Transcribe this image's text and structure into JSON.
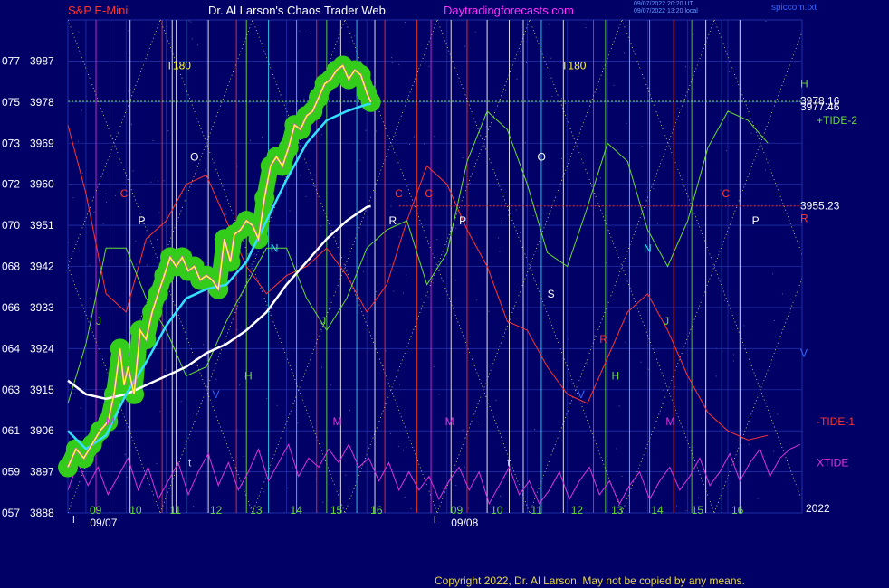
{
  "header": {
    "instrument": "S&P E-Mini",
    "site": "Dr. Al Larson's Chaos Trader Web",
    "url": "Daytradingforecasts.com",
    "stamp1": "09/07/2022 20:20 UT",
    "stamp2": "09/07/2022 13:20 local",
    "file": "spiccom.txt"
  },
  "copyright": "Copyright 2022, Dr. Al Larson. May not be copied by any means.",
  "colors": {
    "background": "#000066",
    "grid": "#1f2fa8",
    "price": "#ffff33",
    "ema_cyan": "#33e0ff",
    "ema_white": "#ffffff",
    "glow": "#33cc1a",
    "tide_plus": "#66dd33",
    "tide_minus": "#ff3333",
    "xtide": "#dd33dd"
  },
  "chart_data": {
    "type": "line",
    "ylim": [
      3888,
      3996
    ],
    "y_ticks": [
      {
        "price": 3888,
        "left": "057",
        "label": "3888"
      },
      {
        "price": 3897,
        "left": "059",
        "label": "3897"
      },
      {
        "price": 3906,
        "left": "061",
        "label": "3906"
      },
      {
        "price": 3915,
        "left": "063",
        "label": "3915"
      },
      {
        "price": 3924,
        "left": "064",
        "label": "3924"
      },
      {
        "price": 3933,
        "left": "066",
        "label": "3933"
      },
      {
        "price": 3942,
        "left": "068",
        "label": "3942"
      },
      {
        "price": 3951,
        "left": "070",
        "label": "3951"
      },
      {
        "price": 3960,
        "left": "072",
        "label": "3960"
      },
      {
        "price": 3969,
        "left": "073",
        "label": "3969"
      },
      {
        "price": 3978,
        "left": "075",
        "label": "3978"
      },
      {
        "price": 3987,
        "left": "077",
        "label": "3987"
      }
    ],
    "xlim": [
      8.55,
      26.85
    ],
    "x_ticks": [
      {
        "t": 9,
        "label": "09"
      },
      {
        "t": 10,
        "label": "10"
      },
      {
        "t": 11,
        "label": "11"
      },
      {
        "t": 12,
        "label": "12"
      },
      {
        "t": 13,
        "label": "13"
      },
      {
        "t": 14,
        "label": "14"
      },
      {
        "t": 15,
        "label": "15"
      },
      {
        "t": 16,
        "label": "16"
      },
      {
        "t": 18,
        "label": "09"
      },
      {
        "t": 19,
        "label": "10"
      },
      {
        "t": 20,
        "label": "11"
      },
      {
        "t": 21,
        "label": "12"
      },
      {
        "t": 22,
        "label": "13"
      },
      {
        "t": 23,
        "label": "14"
      },
      {
        "t": 24,
        "label": "15"
      },
      {
        "t": 25,
        "label": "16"
      }
    ],
    "date_labels": [
      {
        "t": 9.1,
        "label": "09/07"
      },
      {
        "t": 18.1,
        "label": "09/08"
      }
    ],
    "year_label": "2022",
    "right_labels": [
      {
        "price": 3982,
        "text": "H",
        "color": "#66dd33"
      },
      {
        "price": 3978.3,
        "text": "3978.16",
        "color": "#ffffff"
      },
      {
        "price": 3977,
        "text": "3977.46",
        "color": "#ffffff"
      },
      {
        "price": 3974,
        "text": "+TIDE-2",
        "color": "#66dd33"
      },
      {
        "price": 3955.23,
        "text": "3955.23",
        "color": "#ffffff"
      },
      {
        "price": 3952.5,
        "text": "R",
        "color": "#ff3333"
      },
      {
        "price": 3923,
        "text": "V",
        "color": "#3366ff"
      },
      {
        "price": 3908,
        "text": "-TIDE-1",
        "color": "#ff3333"
      },
      {
        "price": 3899,
        "text": "XTIDE",
        "color": "#dd33dd"
      }
    ],
    "annotations": [
      {
        "t": 11.0,
        "price": 3986,
        "text": "T180",
        "color": "#ffff33"
      },
      {
        "t": 20.85,
        "price": 3986,
        "text": "T180",
        "color": "#ffff33"
      },
      {
        "t": 11.6,
        "price": 3966,
        "text": "O",
        "color": "#ffffff"
      },
      {
        "t": 20.25,
        "price": 3966,
        "text": "O",
        "color": "#ffffff"
      },
      {
        "t": 9.85,
        "price": 3958,
        "text": "C",
        "color": "#ff3333"
      },
      {
        "t": 16.7,
        "price": 3958,
        "text": "C",
        "color": "#ff3333"
      },
      {
        "t": 17.45,
        "price": 3958,
        "text": "C",
        "color": "#ff3333"
      },
      {
        "t": 24.85,
        "price": 3958,
        "text": "C",
        "color": "#ff3333"
      },
      {
        "t": 10.3,
        "price": 3952,
        "text": "P",
        "color": "#ffffff"
      },
      {
        "t": 18.3,
        "price": 3952,
        "text": "P",
        "color": "#ffffff"
      },
      {
        "t": 25.6,
        "price": 3952,
        "text": "P",
        "color": "#ffffff"
      },
      {
        "t": 16.55,
        "price": 3952,
        "text": "R",
        "color": "#ffffff"
      },
      {
        "t": 13.6,
        "price": 3946,
        "text": "N",
        "color": "#33e0ff"
      },
      {
        "t": 22.9,
        "price": 3946,
        "text": "N",
        "color": "#33e0ff"
      },
      {
        "t": 20.5,
        "price": 3936,
        "text": "S",
        "color": "#ffffff"
      },
      {
        "t": 9.25,
        "price": 3930,
        "text": "J",
        "color": "#66dd33"
      },
      {
        "t": 14.85,
        "price": 3930,
        "text": "J",
        "color": "#66dd33"
      },
      {
        "t": 23.4,
        "price": 3930,
        "text": "J",
        "color": "#66dd33"
      },
      {
        "t": 21.8,
        "price": 3926,
        "text": "R",
        "color": "#ff3333"
      },
      {
        "t": 12.95,
        "price": 3918,
        "text": "H",
        "color": "#66dd33"
      },
      {
        "t": 22.1,
        "price": 3918,
        "text": "H",
        "color": "#66dd33"
      },
      {
        "t": 12.15,
        "price": 3914,
        "text": "V",
        "color": "#3366ff"
      },
      {
        "t": 21.25,
        "price": 3914,
        "text": "V",
        "color": "#3366ff"
      },
      {
        "t": 9.5,
        "price": 3908,
        "text": "M",
        "color": "#dd33dd"
      },
      {
        "t": 15.15,
        "price": 3908,
        "text": "M",
        "color": "#dd33dd"
      },
      {
        "t": 17.95,
        "price": 3908,
        "text": "M",
        "color": "#dd33dd"
      },
      {
        "t": 23.45,
        "price": 3908,
        "text": "M",
        "color": "#dd33dd"
      },
      {
        "t": 11.55,
        "price": 3899,
        "text": "t",
        "color": "#ccccff"
      },
      {
        "t": 19.5,
        "price": 3899,
        "text": "t",
        "color": "#ccccff"
      }
    ],
    "vertical_lines": [
      {
        "t": 9.25,
        "color": "#dd33dd"
      },
      {
        "t": 9.6,
        "color": "#ff3333"
      },
      {
        "t": 10.1,
        "color": "#ffffff"
      },
      {
        "t": 10.9,
        "color": "#ff3333"
      },
      {
        "t": 11.15,
        "color": "#ffffff"
      },
      {
        "t": 11.25,
        "color": "#ffffff"
      },
      {
        "t": 11.5,
        "color": "#33e0ff"
      },
      {
        "t": 12.05,
        "color": "#ffffff"
      },
      {
        "t": 12.75,
        "color": "#ff3333"
      },
      {
        "t": 13.0,
        "color": "#66dd33"
      },
      {
        "t": 13.55,
        "color": "#33e0ff"
      },
      {
        "t": 14.25,
        "color": "#33e0ff"
      },
      {
        "t": 14.75,
        "color": "#ff3333"
      },
      {
        "t": 15.0,
        "color": "#66dd33"
      },
      {
        "t": 15.35,
        "color": "#ffffff"
      },
      {
        "t": 15.75,
        "color": "#33e0ff"
      },
      {
        "t": 16.2,
        "color": "#ffffff"
      },
      {
        "t": 16.45,
        "color": "#ff3333"
      },
      {
        "t": 17.25,
        "color": "#ff3333"
      },
      {
        "t": 17.6,
        "color": "#dd33dd"
      },
      {
        "t": 18.1,
        "color": "#ffffff"
      },
      {
        "t": 18.5,
        "color": "#ff3333"
      },
      {
        "t": 19.0,
        "color": "#ffffff"
      },
      {
        "t": 19.55,
        "color": "#ffffff"
      },
      {
        "t": 19.9,
        "color": "#ffffff"
      },
      {
        "t": 20.35,
        "color": "#33e0ff"
      },
      {
        "t": 20.9,
        "color": "#ffffff"
      },
      {
        "t": 21.65,
        "color": "#ff3333"
      },
      {
        "t": 21.95,
        "color": "#66dd33"
      },
      {
        "t": 22.55,
        "color": "#33e0ff"
      },
      {
        "t": 23.05,
        "color": "#33e0ff"
      },
      {
        "t": 23.65,
        "color": "#ff3333"
      },
      {
        "t": 24.1,
        "color": "#66dd33"
      },
      {
        "t": 24.45,
        "color": "#ffffff"
      },
      {
        "t": 24.85,
        "color": "#33e0ff"
      },
      {
        "t": 25.3,
        "color": "#ffffff"
      }
    ],
    "h_lines": [
      {
        "price": 3978.16,
        "color": "#66dd33",
        "from": 8.55
      },
      {
        "price": 3955.23,
        "color": "#ff3333",
        "from": 16.8
      }
    ],
    "series": [
      {
        "name": "price",
        "color": "#ffff33",
        "x": [
          8.55,
          8.75,
          8.95,
          9.15,
          9.35,
          9.55,
          9.7,
          9.85,
          9.95,
          10.05,
          10.2,
          10.35,
          10.5,
          10.65,
          10.8,
          10.95,
          11.1,
          11.25,
          11.4,
          11.55,
          11.7,
          11.85,
          12.0,
          12.15,
          12.3,
          12.45,
          12.6,
          12.7,
          12.85,
          13.0,
          13.15,
          13.3,
          13.45,
          13.6,
          13.75,
          13.9,
          14.05,
          14.2,
          14.35,
          14.5,
          14.65,
          14.8,
          14.95,
          15.1,
          15.25,
          15.4,
          15.55,
          15.7,
          15.85,
          16.0,
          16.1
        ],
        "values": [
          3898,
          3902,
          3900,
          3903,
          3906,
          3908,
          3914,
          3924,
          3916,
          3920,
          3914,
          3928,
          3926,
          3932,
          3936,
          3940,
          3944,
          3942,
          3944,
          3941,
          3942,
          3939,
          3940,
          3939,
          3937,
          3948,
          3943,
          3949,
          3950,
          3952,
          3951,
          3948,
          3957,
          3964,
          3966,
          3964,
          3968,
          3973,
          3972,
          3975,
          3976,
          3979,
          3982,
          3983,
          3985,
          3986,
          3983,
          3985,
          3984,
          3980,
          3978
        ]
      },
      {
        "name": "ema",
        "color": "#33e0ff",
        "x": [
          8.55,
          9.0,
          9.5,
          10.0,
          10.5,
          11.0,
          11.5,
          12.0,
          12.5,
          13.0,
          13.5,
          14.0,
          14.5,
          15.0,
          15.5,
          16.0,
          16.1
        ],
        "values": [
          3906,
          3902,
          3905,
          3914,
          3921,
          3929,
          3935,
          3937,
          3938,
          3943,
          3952,
          3961,
          3969,
          3974,
          3976,
          3977.5,
          3977.6
        ]
      },
      {
        "name": "ema-slow",
        "color": "#ffffff",
        "x": [
          8.55,
          9.0,
          9.5,
          10.0,
          10.5,
          11.0,
          11.5,
          12.0,
          12.5,
          13.0,
          13.5,
          14.0,
          14.5,
          15.0,
          15.5,
          16.0,
          16.1
        ],
        "values": [
          3917,
          3914,
          3913,
          3914,
          3916,
          3918,
          3920,
          3923,
          3925,
          3928,
          3932,
          3938,
          3943,
          3948,
          3952,
          3955,
          3955.2
        ]
      },
      {
        "name": "+TIDE-2",
        "color": "#66dd33",
        "x": [
          8.55,
          9.0,
          9.5,
          10.0,
          10.5,
          11.0,
          11.5,
          12.0,
          12.5,
          13.0,
          13.5,
          14.0,
          14.5,
          15.0,
          15.5,
          16.0,
          16.5,
          17.0,
          17.5,
          18.0,
          18.5,
          19.0,
          19.5,
          20.0,
          20.5,
          21.0,
          21.5,
          22.0,
          22.5,
          23.0,
          23.5,
          24.0,
          24.5,
          25.0,
          25.5,
          26.0
        ],
        "values": [
          3912,
          3925,
          3946,
          3946,
          3935,
          3928,
          3918,
          3920,
          3930,
          3938,
          3946,
          3946,
          3935,
          3928,
          3935,
          3946,
          3950,
          3952,
          3938,
          3945,
          3965,
          3976,
          3972,
          3960,
          3945,
          3942,
          3955,
          3969,
          3965,
          3950,
          3942,
          3952,
          3968,
          3976,
          3974,
          3969
        ]
      },
      {
        "name": "-TIDE-1",
        "color": "#ff3333",
        "x": [
          8.55,
          9.0,
          9.5,
          10.0,
          10.5,
          11.0,
          11.5,
          12.0,
          12.5,
          13.0,
          13.5,
          14.0,
          14.5,
          15.0,
          15.5,
          16.0,
          16.5,
          17.0,
          17.5,
          18.0,
          18.5,
          19.0,
          19.5,
          20.0,
          20.5,
          21.0,
          21.5,
          22.0,
          22.5,
          23.0,
          23.5,
          24.0,
          24.5,
          25.0,
          25.5,
          26.0
        ],
        "values": [
          3973,
          3958,
          3936,
          3932,
          3948,
          3952,
          3960,
          3962,
          3952,
          3942,
          3936,
          3940,
          3942,
          3946,
          3940,
          3932,
          3938,
          3952,
          3964,
          3960,
          3950,
          3942,
          3930,
          3928,
          3920,
          3914,
          3912,
          3922,
          3932,
          3936,
          3928,
          3918,
          3910,
          3906,
          3904,
          3905
        ]
      },
      {
        "name": "XTIDE",
        "color": "#dd33dd",
        "x": [
          8.55,
          8.8,
          9.05,
          9.3,
          9.55,
          9.8,
          10.05,
          10.3,
          10.55,
          10.8,
          11.05,
          11.3,
          11.55,
          11.8,
          12.05,
          12.3,
          12.55,
          12.8,
          13.05,
          13.3,
          13.55,
          13.8,
          14.05,
          14.3,
          14.55,
          14.8,
          15.05,
          15.3,
          15.55,
          15.8,
          16.05,
          16.3,
          16.55,
          16.8,
          17.05,
          17.3,
          17.55,
          17.8,
          18.05,
          18.3,
          18.55,
          18.8,
          19.05,
          19.3,
          19.55,
          19.8,
          20.05,
          20.3,
          20.55,
          20.8,
          21.05,
          21.3,
          21.55,
          21.8,
          22.05,
          22.3,
          22.55,
          22.8,
          23.05,
          23.3,
          23.55,
          23.8,
          24.05,
          24.3,
          24.55,
          24.8,
          25.05,
          25.3,
          25.55,
          25.8,
          26.05,
          26.3,
          26.55,
          26.8
        ],
        "values": [
          3893,
          3899,
          3894,
          3898,
          3892,
          3896,
          3900,
          3893,
          3898,
          3891,
          3895,
          3899,
          3892,
          3897,
          3901,
          3894,
          3899,
          3893,
          3897,
          3902,
          3895,
          3899,
          3903,
          3896,
          3900,
          3898,
          3902,
          3899,
          3903,
          3898,
          3900,
          3895,
          3899,
          3893,
          3897,
          3893,
          3896,
          3891,
          3895,
          3898,
          3893,
          3897,
          3890,
          3894,
          3898,
          3892,
          3895,
          3890,
          3893,
          3897,
          3891,
          3895,
          3898,
          3892,
          3895,
          3890,
          3894,
          3897,
          3891,
          3895,
          3898,
          3893,
          3896,
          3900,
          3894,
          3897,
          3901,
          3895,
          3899,
          3902,
          3896,
          3900,
          3902,
          3903
        ]
      }
    ]
  }
}
